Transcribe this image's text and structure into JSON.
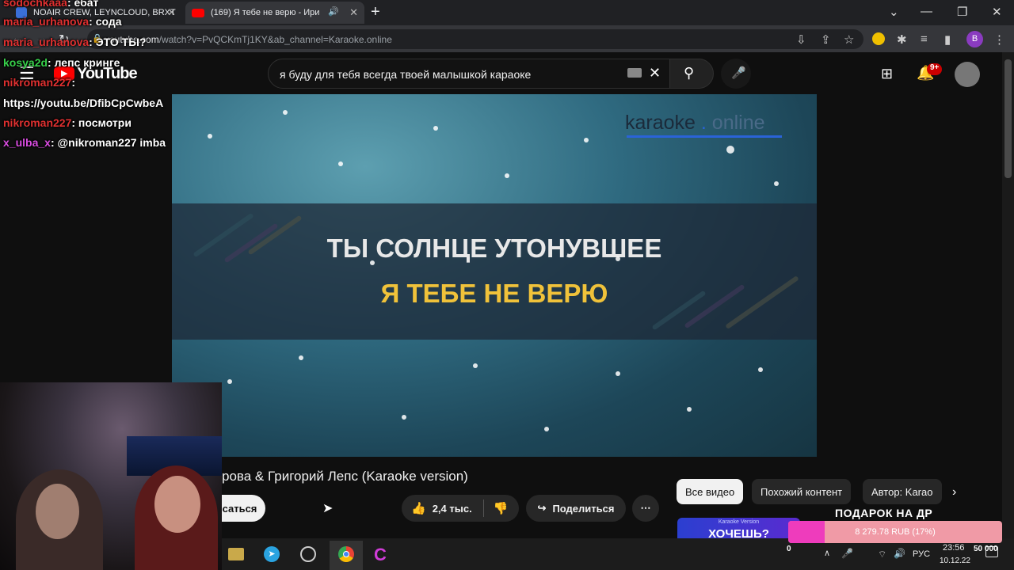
{
  "browser": {
    "tabs": [
      {
        "title": "NOAIR CREW, LEYNCLOUD, BRXT"
      },
      {
        "title": "(169) Я тебе не верю - Ири"
      }
    ],
    "url_host": "youtube.com",
    "url_path": "/watch?v=PvQCKmTj1KY&ab_channel=Karaoke.online",
    "profile_initial": "B"
  },
  "youtube": {
    "logo_text": "YouTube",
    "search_value": "я буду для тебя всегда твоей малышкой караоке",
    "notification_badge": "9+"
  },
  "video": {
    "brand": "karaoke.online",
    "brand_part1": "karaoke",
    "brand_part2": "online",
    "lyric_line_1": "ТЫ СОЛНЦЕ УТОНУВШЕЕ",
    "lyric_line_2": "Я ТЕБЕ НЕ ВЕРЮ"
  },
  "below_video": {
    "title": "рова & Григорий Лепс (Karaoke version)",
    "subscribe_label": "саться",
    "likes": "2,4 тыс.",
    "share_label": "Поделиться",
    "chips": [
      "Все видео",
      "Похожий контент",
      "Автор: Karao"
    ],
    "promo_small": "Karaoke Version",
    "promo_text": "ХОЧЕШЬ?"
  },
  "chat": [
    {
      "user": "sodochkaaa",
      "sep": ": ",
      "text": "ебат",
      "color": "red"
    },
    {
      "user": "maria_urhanova",
      "sep": ": ",
      "text": "сода",
      "color": "red"
    },
    {
      "user": "maria_urhanova",
      "sep": ": ",
      "text": "ЭТО ТЫ?",
      "color": "red"
    },
    {
      "user": "kosya2d",
      "sep": ": ",
      "text": "лепс кринге",
      "color": "green"
    },
    {
      "user": "nikroman227",
      "sep": ":",
      "text": "",
      "color": "red"
    },
    {
      "user": "",
      "sep": "",
      "text": "https://youtu.be/DfibCpCwbeA",
      "color": "white"
    },
    {
      "user": "nikroman227",
      "sep": ": ",
      "text": "посмотри",
      "color": "red"
    },
    {
      "user": "x_ulba_x",
      "sep": ": ",
      "text": "@nikroman227 imba",
      "color": "purple"
    }
  ],
  "stream_overlay": {
    "gift_title": "ПОДАРОК НА ДР",
    "donation_text": "8 279.78 RUB (17%)",
    "donation_goal": "50 000",
    "donation_start": "0",
    "donation_percent": 17
  },
  "taskbar": {
    "lang": "РУС",
    "time": "23:56",
    "date": "10.12.22"
  },
  "colors": {
    "accent_red": "#e03030",
    "karaoke_yellow": "#f0c23a",
    "donation_pink": "#ee3cbc"
  }
}
